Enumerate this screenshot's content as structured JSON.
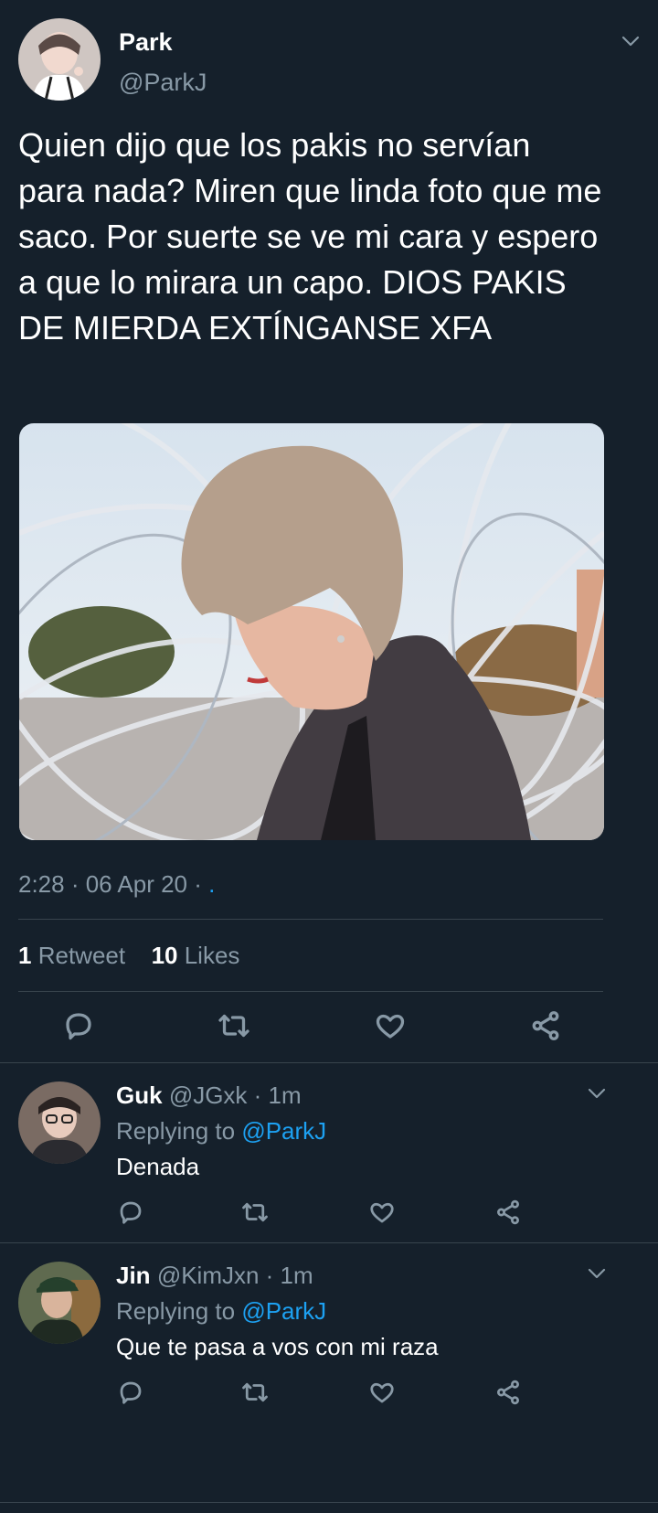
{
  "tweet": {
    "author_name": "Park",
    "author_handle": "@ParkJ",
    "text": "Quien dijo que los pakis no servían para nada? Miren que linda foto que me saco. Por suerte se ve mi cara y espero a que lo mirara un capo. DIOS PAKIS DE MIERDA EXTÍNGANSE XFA",
    "timestamp": "2:28 · 06 Apr 20 ·",
    "timestamp_dot": ".",
    "retweets_count": "1",
    "retweets_label": "Retweet",
    "likes_count": "10",
    "likes_label": "Likes"
  },
  "replies": [
    {
      "name": "Guk",
      "meta": "@JGxk · 1m",
      "replying_prefix": "Replying to",
      "replying_handle": "@ParkJ",
      "text": "Denada"
    },
    {
      "name": "Jin",
      "meta": "@KimJxn · 1m",
      "replying_prefix": "Replying to",
      "replying_handle": "@ParkJ",
      "text": "Que te pasa a vos con mi raza"
    }
  ],
  "colors": {
    "background": "#15202b",
    "divider": "#38444d",
    "muted": "#8899a6",
    "link": "#1da1f2"
  },
  "icons": [
    "chevron-down-icon",
    "reply-icon",
    "retweet-icon",
    "like-icon",
    "share-icon"
  ]
}
